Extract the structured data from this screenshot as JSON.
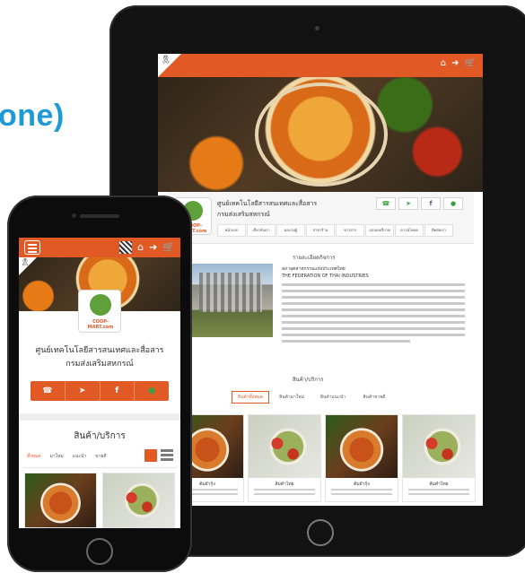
{
  "background": {
    "headline_fragment": "one)",
    "headline_color": "#1e9ad6"
  },
  "colors": {
    "accent": "#e15a25",
    "line_green": "#3aa043"
  },
  "tablet": {
    "header_icons": [
      "home-icon",
      "login-icon",
      "cart-icon"
    ],
    "store": {
      "title_line1": "ศูนย์เทคโนโลยีสารสนเทศและสื่อสาร",
      "title_line2": "กรมส่งเสริมสหกรณ์",
      "logo_text": "COOP-MART.com"
    },
    "social_icons": [
      "phone-icon",
      "location-icon",
      "facebook-icon",
      "line-icon"
    ],
    "nav_items": [
      "หน้าแรก",
      "เกี่ยวกับเรา",
      "ผลงานผู้",
      "สาขาร้าน",
      "ข่าวสาร",
      "แกลเลอรี่ภาพ",
      "ดาวน์โหลด",
      "ติดต่อเรา"
    ],
    "about": {
      "heading": "รายละเอียดกิจการ",
      "name_th": "สภาอุตสาหกรรมแห่งประเทศไทย",
      "name_en": "THE FEDERATION OF THAI INDUSTRIES"
    },
    "products": {
      "heading": "สินค้า/บริการ",
      "tabs": [
        "สินค้าทั้งหมด",
        "สินค้ามาใหม่",
        "สินค้าแนะนำ",
        "สินค้าขายดี"
      ],
      "active_tab": 0,
      "cards": [
        {
          "name": "ต้มยำกุ้ง"
        },
        {
          "name": "ส้มตำไทย"
        },
        {
          "name": "ต้มยำกุ้ง"
        },
        {
          "name": "ส้มตำไทย"
        }
      ]
    }
  },
  "phone": {
    "header_icons": [
      "qr-code-icon",
      "home-icon",
      "login-icon",
      "cart-icon"
    ],
    "store": {
      "title_line1": "ศูนย์เทคโนโลยีสารสนเทศและสื่อสาร",
      "title_line2": "กรมส่งเสริมสหกรณ์",
      "logo_text": "COOP-MART.com"
    },
    "action_icons": [
      "phone-icon",
      "location-icon",
      "facebook-icon",
      "line-icon"
    ],
    "products": {
      "heading": "สินค้า/บริการ",
      "tabs": [
        "ทั้งหมด",
        "มาใหม่",
        "แนะนำ",
        "ขายดี"
      ],
      "active_tab": 0,
      "view_modes": [
        "grid-view-icon",
        "list-view-icon"
      ]
    }
  }
}
